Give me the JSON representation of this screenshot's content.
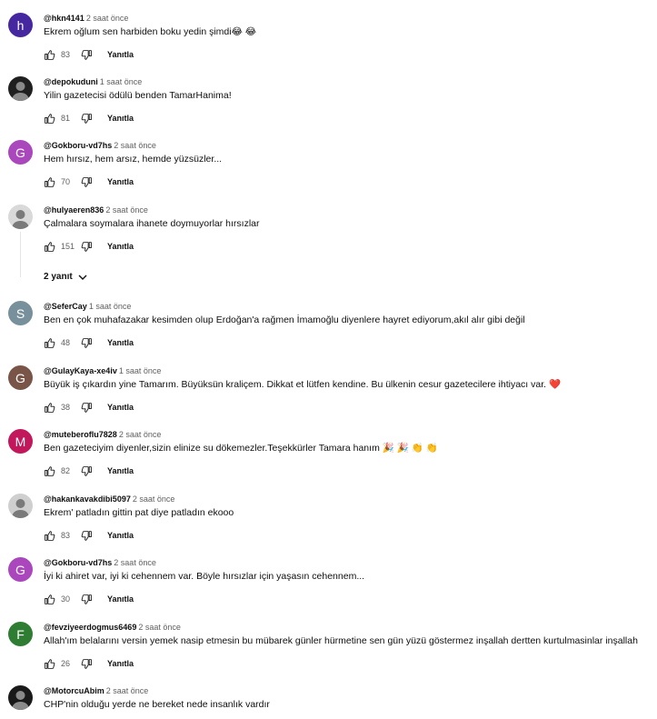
{
  "comments": [
    {
      "handle": "@hkn4141",
      "time": "2 saat önce",
      "text": "Ekrem oğlum sen harbiden boku yedin şimdi😂 😂",
      "likes": "83",
      "reply": "Yanıtla",
      "avatar_letter": "h",
      "avatar_color": "#4527a0"
    },
    {
      "handle": "@depokuduni",
      "time": "1 saat önce",
      "text": "Yilin  gazetecisi ödülü benden TamarHanima!",
      "likes": "81",
      "reply": "Yanıtla",
      "avatar_letter": "",
      "avatar_color": "#202020"
    },
    {
      "handle": "@Gokboru-vd7hs",
      "time": "2 saat önce",
      "text": "Hem hırsız, hem arsız, hemde yüzsüzler...",
      "likes": "70",
      "reply": "Yanıtla",
      "avatar_letter": "G",
      "avatar_color": "#ab47bc"
    },
    {
      "handle": "@hulyaeren836",
      "time": "2 saat önce",
      "text": "Çalmalara soymalara ihanete doymuyorlar hırsızlar",
      "likes": "151",
      "reply": "Yanıtla",
      "avatar_letter": "",
      "avatar_color": "#d9d9d9",
      "replies_label": "2 yanıt"
    },
    {
      "handle": "@SeferCay",
      "time": "1 saat önce",
      "text": "Ben en çok muhafazakar kesimden olup Erdoğan'a rağmen İmamoğlu diyenlere hayret ediyorum,akıl alır gibi değil",
      "likes": "48",
      "reply": "Yanıtla",
      "avatar_letter": "S",
      "avatar_color": "#78909c"
    },
    {
      "handle": "@GulayKaya-xe4iv",
      "time": "1 saat önce",
      "text": "Büyük iş çıkardın yine Tamarım. Büyüksün kraliçem. Dikkat et lütfen kendine. Bu ülkenin cesur gazetecilere ihtiyacı var. ❤️",
      "likes": "38",
      "reply": "Yanıtla",
      "avatar_letter": "G",
      "avatar_color": "#795548"
    },
    {
      "handle": "@muteberoflu7828",
      "time": "2 saat önce",
      "text": "Ben gazeteciyim diyenler,sizin elinize su dökemezler.Teşekkürler Tamara hanım 🎉 🎉 👏 👏",
      "likes": "82",
      "reply": "Yanıtla",
      "avatar_letter": "M",
      "avatar_color": "#c2185b"
    },
    {
      "handle": "@hakankavakdibi5097",
      "time": "2 saat önce",
      "text": "Ekrem' patladın gittin pat diye patladın ekooo",
      "likes": "83",
      "reply": "Yanıtla",
      "avatar_letter": "",
      "avatar_color": "#cfcfcf"
    },
    {
      "handle": "@Gokboru-vd7hs",
      "time": "2 saat önce",
      "text": "İyi ki ahiret var, iyi ki cehennem var. Böyle hırsızlar için yaşasın cehennem...",
      "likes": "30",
      "reply": "Yanıtla",
      "avatar_letter": "G",
      "avatar_color": "#ab47bc"
    },
    {
      "handle": "@fevziyeerdogmus6469",
      "time": "2 saat önce",
      "text": "Allah'ım belalarını versin yemek nasip etmesin bu mübarek günler hürmetine sen gün yüzü göstermez inşallah dertten kurtulmasinlar inşallah",
      "likes": "26",
      "reply": "Yanıtla",
      "avatar_letter": "F",
      "avatar_color": "#2e7d32"
    },
    {
      "handle": "@MotorcuAbim",
      "time": "2 saat önce",
      "text": "CHP'nin olduğu yerde ne bereket nede insanlık vardır",
      "likes": "",
      "reply": "",
      "avatar_letter": "",
      "avatar_color": "#1a1a1a"
    }
  ],
  "icons": {
    "like": "thumbs-up-icon",
    "dislike": "thumbs-down-icon",
    "expand": "chevron-down-icon"
  }
}
